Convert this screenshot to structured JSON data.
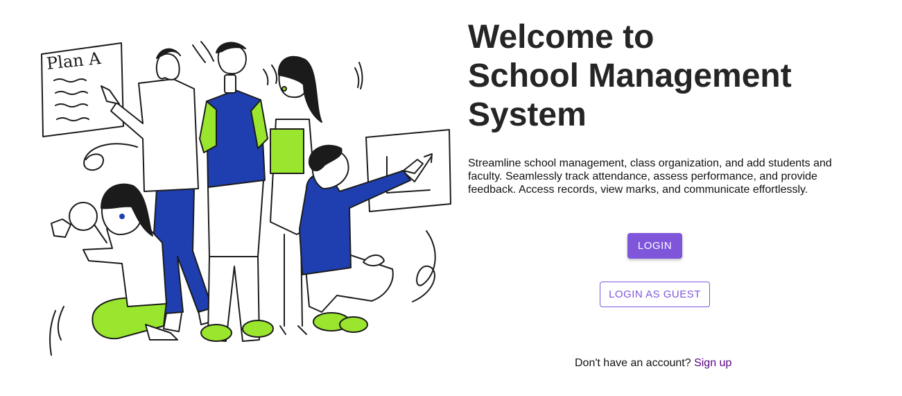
{
  "hero": {
    "title_line1": "Welcome to",
    "title_line2": "School Management",
    "title_line3": "System",
    "description": "Streamline school management, class organization, and add students and faculty. Seamlessly track attendance, assess performance, and provide feedback. Access records, view marks, and communicate effortlessly."
  },
  "illustration": {
    "board_text": "Plan A"
  },
  "actions": {
    "login_label": "LOGIN",
    "guest_label": "LOGIN AS GUEST"
  },
  "signup": {
    "prompt": "Don't have an account?",
    "link_label": "Sign up"
  },
  "colors": {
    "accent": "#7f56da",
    "link": "#550080",
    "illustration_blue": "#1f3fb0",
    "illustration_green": "#9ae62e"
  }
}
